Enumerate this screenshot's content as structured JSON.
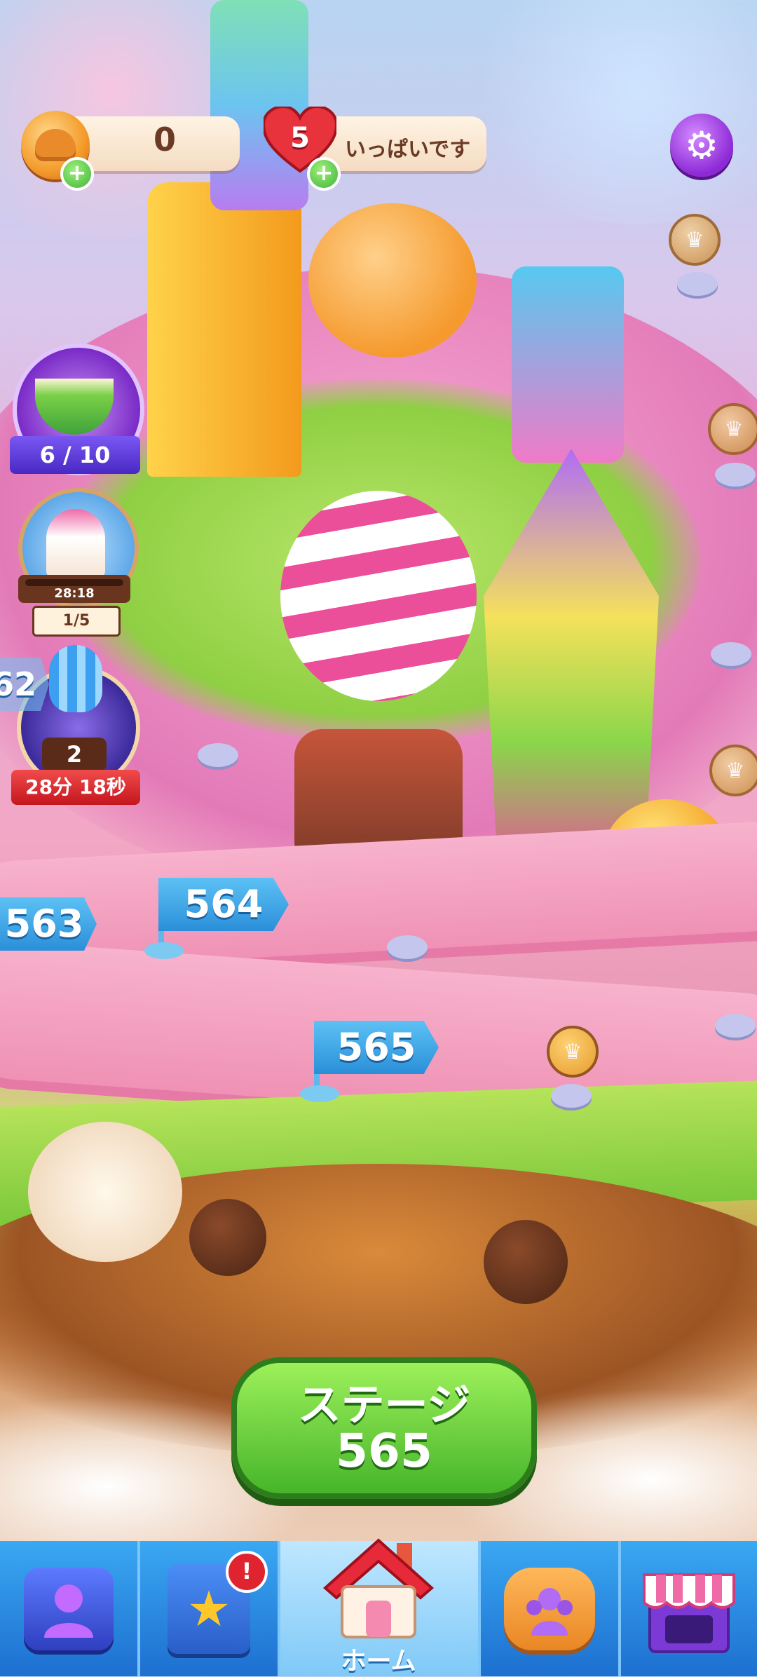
{
  "hud": {
    "coins": {
      "value": "0",
      "icon": "chef-hat-coin-icon"
    },
    "lives": {
      "count": "5",
      "status": "いっぱいです",
      "icon": "heart-icon"
    },
    "settings_icon": "gear-icon"
  },
  "events": {
    "bowl": {
      "progress": "6 / 10",
      "icon": "mixing-bowl-icon"
    },
    "icecream": {
      "timer": "28:18",
      "progress": "1/5",
      "icon": "ice-cream-icon"
    },
    "balloon": {
      "count": "2",
      "timer": "28分 18秒",
      "icon": "hot-air-balloon-icon"
    }
  },
  "map": {
    "stages": [
      {
        "number": "563"
      },
      {
        "number": "564"
      },
      {
        "number": "565"
      }
    ],
    "partial_stage_left": "62"
  },
  "play_button": {
    "line1": "ステージ",
    "line2": "565"
  },
  "nav": {
    "items": [
      {
        "id": "profile",
        "icon": "profile-icon"
      },
      {
        "id": "book",
        "icon": "star-book-icon",
        "badge": "!"
      },
      {
        "id": "home",
        "icon": "home-icon",
        "label": "ホーム"
      },
      {
        "id": "team",
        "icon": "team-icon"
      },
      {
        "id": "shop",
        "icon": "shop-icon"
      }
    ]
  },
  "colors": {
    "accent": "#46b52a",
    "nav_bg": "#1d6fd0",
    "flag": "#2a8fd8",
    "settings": "#8d29d6"
  }
}
